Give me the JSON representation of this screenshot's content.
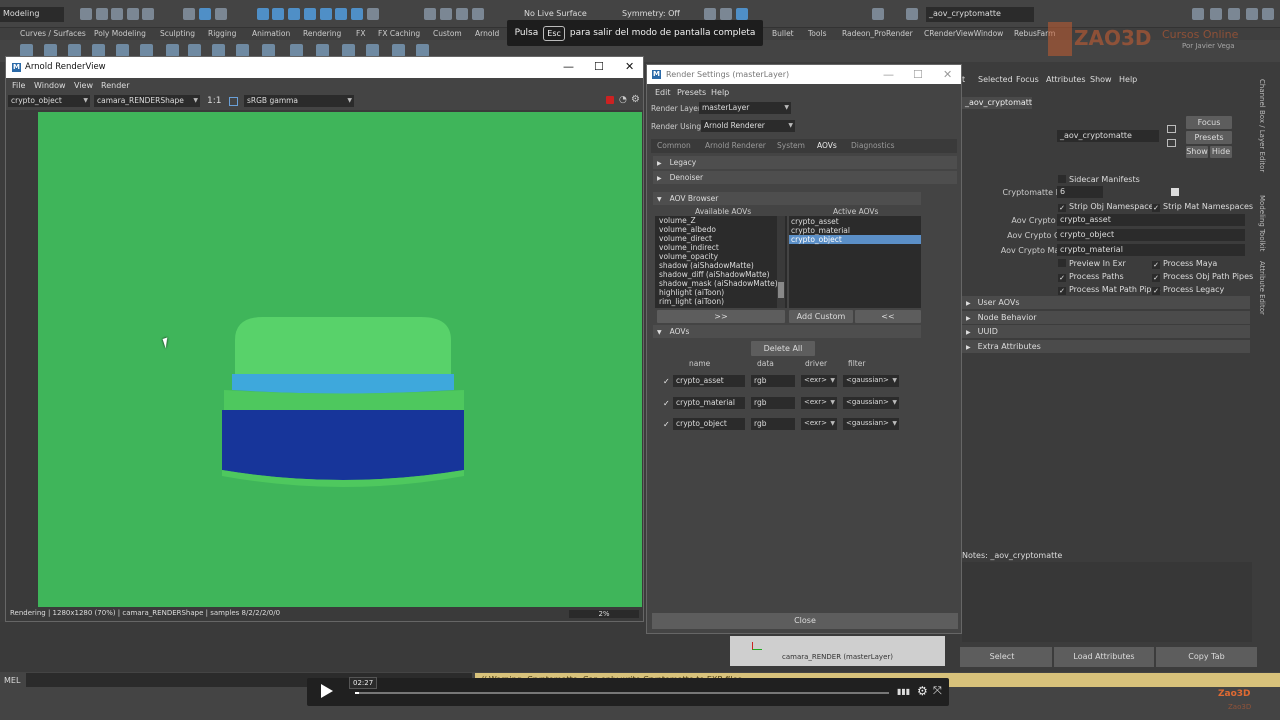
{
  "maya": {
    "mode": "Modeling",
    "live_surface": "No Live Surface",
    "symmetry": "Symmetry: Off",
    "field_value": "_aov_cryptomatte",
    "shelf_tabs": [
      "Curves / Surfaces",
      "Poly Modeling",
      "Sculpting",
      "Rigging",
      "Animation",
      "Rendering",
      "FX",
      "FX Caching",
      "Custom",
      "Arnold",
      "Bullet",
      "Tools",
      "Radeon_ProRender",
      "CRenderViewWindow",
      "RebusFarm"
    ]
  },
  "banner": {
    "pre": "Pulsa",
    "key": "Esc",
    "post": "para salir del modo de pantalla completa"
  },
  "brand": {
    "logo": "ZAO3D",
    "cursos": "Cursos Online",
    "author": "Por Javier Vega",
    "bottom": "Zao3D",
    "bottom2": "Zao3D"
  },
  "renderview": {
    "title": "Arnold RenderView",
    "menu": [
      "File",
      "Window",
      "View",
      "Render"
    ],
    "aov_select": "crypto_object",
    "camera_select": "camara_RENDERShape",
    "ratio": "1:1",
    "color_space": "sRGB gamma",
    "status": "Rendering | 1280x1280 (70%) | camara_RENDERShape | samples 8/2/2/2/0/0",
    "progress": "2%"
  },
  "render_settings": {
    "title": "Render Settings (masterLayer)",
    "menu": [
      "Edit",
      "Presets",
      "Help"
    ],
    "render_layer_label": "Render Layer",
    "render_layer": "masterLayer",
    "render_using_label": "Render Using",
    "render_using": "Arnold Renderer",
    "tabs": [
      "Common",
      "Arnold Renderer",
      "System",
      "AOVs",
      "Diagnostics"
    ],
    "sections": {
      "legacy": "Legacy",
      "denoiser": "Denoiser",
      "browser": "AOV Browser",
      "aovs": "AOVs"
    },
    "available_label": "Available AOVs",
    "active_label": "Active AOVs",
    "available": [
      "volume_Z",
      "volume_albedo",
      "volume_direct",
      "volume_indirect",
      "volume_opacity",
      "shadow (aiShadowMatte)",
      "shadow_diff (aiShadowMatte)",
      "shadow_mask (aiShadowMatte)",
      "highlight (aiToon)",
      "rim_light (aiToon)"
    ],
    "active": [
      "crypto_asset",
      "crypto_material",
      "crypto_object"
    ],
    "btn_add": ">>",
    "btn_custom": "Add Custom",
    "btn_remove": "<<",
    "delete_all": "Delete All",
    "cols": {
      "name": "name",
      "data": "data",
      "driver": "driver",
      "filter": "filter"
    },
    "rows": [
      {
        "name": "crypto_asset",
        "data": "rgb",
        "driver": "<exr>",
        "filter": "<gaussian>"
      },
      {
        "name": "crypto_material",
        "data": "rgb",
        "driver": "<exr>",
        "filter": "<gaussian>"
      },
      {
        "name": "crypto_object",
        "data": "rgb",
        "driver": "<exr>",
        "filter": "<gaussian>"
      }
    ],
    "close": "Close"
  },
  "attr_editor": {
    "menu": [
      "t",
      "Selected",
      "Focus",
      "Attributes",
      "Show",
      "Help"
    ],
    "tab": "_aov_cryptomatte",
    "crypto_label": "cryptomatte:",
    "crypto_value": "_aov_cryptomatte",
    "focus": "Focus",
    "presets": "Presets",
    "show": "Show",
    "hide": "Hide",
    "sidecar": "Sidecar Manifests",
    "depth_label": "Cryptomatte Depth",
    "depth": "6",
    "strip_obj": "Strip Obj Namespaces",
    "strip_mat": "Strip Mat Namespaces",
    "asset_label": "Aov Crypto Asset",
    "asset": "crypto_asset",
    "object_label": "Aov Crypto Object",
    "object": "crypto_object",
    "material_label": "Aov Crypto Material",
    "material": "crypto_material",
    "preview": "Preview In Exr",
    "proc_maya": "Process Maya",
    "proc_paths": "Process Paths",
    "proc_obj": "Process Obj Path Pipes",
    "proc_mat": "Process Mat Path Pipes",
    "proc_legacy": "Process Legacy",
    "sections": [
      "User AOVs",
      "Node Behavior",
      "UUID",
      "Extra Attributes"
    ],
    "side_tabs": [
      "Channel Box / Layer Editor",
      "Modeling Toolkit",
      "Attribute Editor"
    ],
    "notes": "Notes: _aov_cryptomatte",
    "select": "Select",
    "load": "Load Attributes",
    "copy": "Copy Tab"
  },
  "bottom": {
    "camera": "camara_RENDER (masterLayer)",
    "mel": "MEL",
    "warning": "// Warning: Cryptomatte: Can only write Cryptomatte to EXR files.",
    "time": "02:27"
  },
  "colors": {
    "render_bg": "#3fb55a",
    "top": "#58d26a",
    "blue_band": "#3ea8dc",
    "base": "#17359a",
    "selection": "#5b8fc7"
  },
  "chart_data": null
}
